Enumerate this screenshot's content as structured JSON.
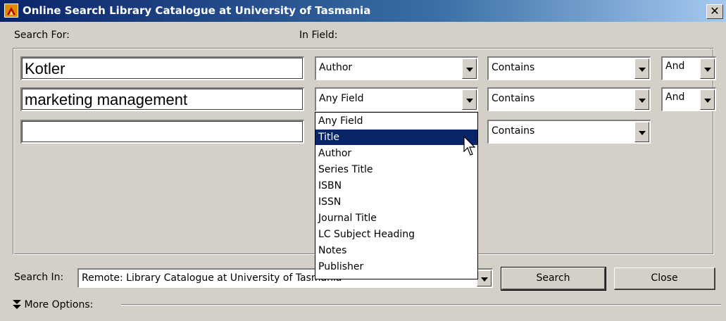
{
  "window": {
    "title": "Online Search Library Catalogue at University of Tasmania",
    "close_glyph": "✕"
  },
  "labels": {
    "search_for": "Search For:",
    "in_field": "In Field:",
    "search_in": "Search In:",
    "more_options": "More Options:"
  },
  "rows": [
    {
      "term": "Kotler",
      "field": "Author",
      "match": "Contains",
      "bool": "And"
    },
    {
      "term": "marketing management",
      "field": "Any Field",
      "match": "Contains",
      "bool": "And"
    },
    {
      "term": "",
      "match": "Contains"
    }
  ],
  "field_options": [
    "Any Field",
    "Title",
    "Author",
    "Series Title",
    "ISBN",
    "ISSN",
    "Journal Title",
    "LC Subject Heading",
    "Notes",
    "Publisher"
  ],
  "highlighted_option": "Title",
  "search_in_value": "Remote: Library Catalogue at University of Tasmania",
  "buttons": {
    "search": "Search",
    "close": "Close"
  },
  "icons": {
    "app": "library-catalogue-icon",
    "close": "close-icon",
    "dropdown": "chevron-down-icon",
    "more": "double-chevron-down-icon",
    "cursor": "mouse-pointer-icon"
  },
  "colors": {
    "titlebar_start": "#0a246a",
    "titlebar_end": "#a6caf0",
    "selection": "#0a246a",
    "window_bg": "#d4d0c8"
  }
}
